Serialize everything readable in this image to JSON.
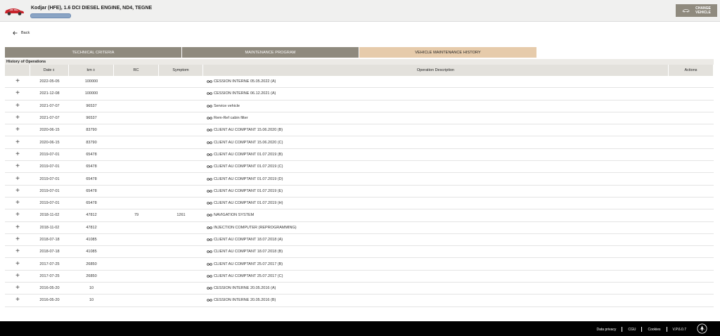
{
  "header": {
    "vehicle_title": "Kodjar (HFE), 1.6 DCI DIESEL ENGINE, ND4, TEGNE",
    "change_vehicle_label": "CHANGE VEHICLE"
  },
  "back_label": "Back",
  "tabs": [
    {
      "label": "TECHNICAL CRITERIA"
    },
    {
      "label": "MAINTENANCE PROGRAM"
    },
    {
      "label": "VEHICLE MAINTENANCE HISTORY"
    }
  ],
  "section_title": "History of Operations",
  "columns": {
    "date": "Date",
    "km": "km",
    "rc": "RC",
    "symptom": "Symptom",
    "description": "Operation Description",
    "actions": "Actions"
  },
  "rows": [
    {
      "date": "2022-05-05",
      "km": "100000",
      "rc": "",
      "symptom": "",
      "desc": "CESSION INTERNE 05.05.2022 (A)"
    },
    {
      "date": "2021-12-08",
      "km": "100000",
      "rc": "",
      "symptom": "",
      "desc": "CESSION INTERNE 06.12.2021 (A)"
    },
    {
      "date": "2021-07-07",
      "km": "96537",
      "rc": "",
      "symptom": "",
      "desc": "Service vehicle"
    },
    {
      "date": "2021-07-07",
      "km": "96537",
      "rc": "",
      "symptom": "",
      "desc": "Rem-Ref cabin filter"
    },
    {
      "date": "2020-06-15",
      "km": "83790",
      "rc": "",
      "symptom": "",
      "desc": "CLIENT AU COMPTANT 15.06.2020 (B)"
    },
    {
      "date": "2020-06-15",
      "km": "83790",
      "rc": "",
      "symptom": "",
      "desc": "CLIENT AU COMPTANT 15.06.2020 (C)"
    },
    {
      "date": "2019-07-01",
      "km": "65478",
      "rc": "",
      "symptom": "",
      "desc": "CLIENT AU COMPTANT 01.07.2019 (B)"
    },
    {
      "date": "2019-07-01",
      "km": "65478",
      "rc": "",
      "symptom": "",
      "desc": "CLIENT AU COMPTANT 01.07.2019 (C)"
    },
    {
      "date": "2019-07-01",
      "km": "65478",
      "rc": "",
      "symptom": "",
      "desc": "CLIENT AU COMPTANT 01.07.2019 (D)"
    },
    {
      "date": "2019-07-01",
      "km": "65478",
      "rc": "",
      "symptom": "",
      "desc": "CLIENT AU COMPTANT 01.07.2019 (E)"
    },
    {
      "date": "2019-07-01",
      "km": "65478",
      "rc": "",
      "symptom": "",
      "desc": "CLIENT AU COMPTANT 01.07.2019 (H)"
    },
    {
      "date": "2018-11-02",
      "km": "47812",
      "rc": "79",
      "symptom": "1261",
      "desc": "NAVIGATION SYSTEM"
    },
    {
      "date": "2018-11-02",
      "km": "47812",
      "rc": "",
      "symptom": "",
      "desc": "INJECTION COMPUTER (REPROGRAMMING)"
    },
    {
      "date": "2018-07-18",
      "km": "41085",
      "rc": "",
      "symptom": "",
      "desc": "CLIENT AU COMPTANT 18.07.2018 (A)"
    },
    {
      "date": "2018-07-18",
      "km": "41085",
      "rc": "",
      "symptom": "",
      "desc": "CLIENT AU COMPTANT 18.07.2018 (B)"
    },
    {
      "date": "2017-07-25",
      "km": "26850",
      "rc": "",
      "symptom": "",
      "desc": "CLIENT AU COMPTANT 25.07.2017 (B)"
    },
    {
      "date": "2017-07-25",
      "km": "26850",
      "rc": "",
      "symptom": "",
      "desc": "CLIENT AU COMPTANT 25.07.2017 (C)"
    },
    {
      "date": "2016-05-20",
      "km": "10",
      "rc": "",
      "symptom": "",
      "desc": "CESSION INTERNE 20.05.2016 (A)"
    },
    {
      "date": "2016-05-20",
      "km": "10",
      "rc": "",
      "symptom": "",
      "desc": "CESSION INTERNE 20.05.2016 (B)"
    }
  ],
  "footer": {
    "links": [
      "Data privacy",
      "CGU",
      "Cookies",
      "V.P.6.0.7"
    ]
  },
  "colors": {
    "tab_inactive": "#8f8a7e",
    "tab_active": "#e6cbab",
    "footer_bg": "#000000",
    "car": "#c8242c"
  }
}
